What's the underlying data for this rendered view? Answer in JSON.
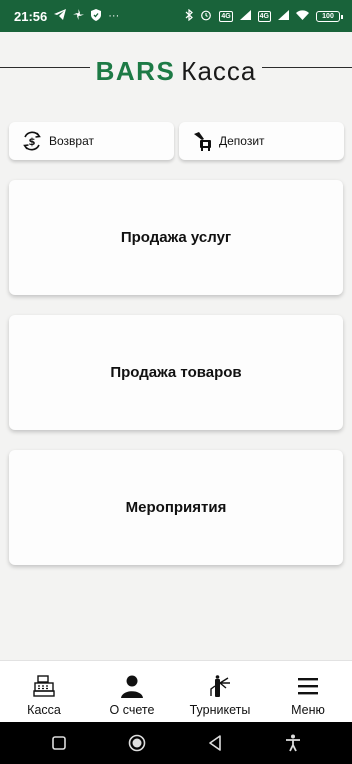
{
  "status_bar": {
    "time": "21:56",
    "dots": "···",
    "battery": "100",
    "sim1": "4G",
    "sim2": "4G"
  },
  "header": {
    "logo_bars": "BARS",
    "logo_kassa": "Касса"
  },
  "quick_actions": {
    "refund_label": "Возврат",
    "deposit_label": "Депозит"
  },
  "cards": {
    "services": "Продажа услуг",
    "goods": "Продажа товаров",
    "events": "Мероприятия"
  },
  "bottom_nav": {
    "kassa": "Касса",
    "account": "О счете",
    "turnstiles": "Турникеты",
    "menu": "Меню"
  },
  "colors": {
    "brand_green": "#1d7a46",
    "status_bar": "#19633a",
    "background": "#f3f3f2"
  }
}
